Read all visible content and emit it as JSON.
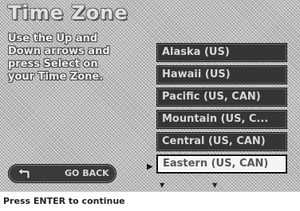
{
  "screen": {
    "title": "Time Zone",
    "instruction": "Use the Up and\nDown arrows and\npress Select on\nyour Time Zone."
  },
  "zones": [
    {
      "label": "Alaska (US)",
      "selected": false
    },
    {
      "label": "Hawaii (US)",
      "selected": false
    },
    {
      "label": "Pacific (US, CAN)",
      "selected": false
    },
    {
      "label": "Mountain (US, C...",
      "selected": false
    },
    {
      "label": "Central (US, CAN)",
      "selected": false
    },
    {
      "label": "Eastern (US, CAN)",
      "selected": true
    }
  ],
  "back_button": {
    "label": "GO BACK",
    "icon": "back-arrow-icon"
  },
  "status_bar": {
    "text": "Press ENTER to continue"
  },
  "colors": {
    "background": "#b8b8b8",
    "zone_item": "#353535",
    "zone_selected": "#f4f4f4"
  }
}
